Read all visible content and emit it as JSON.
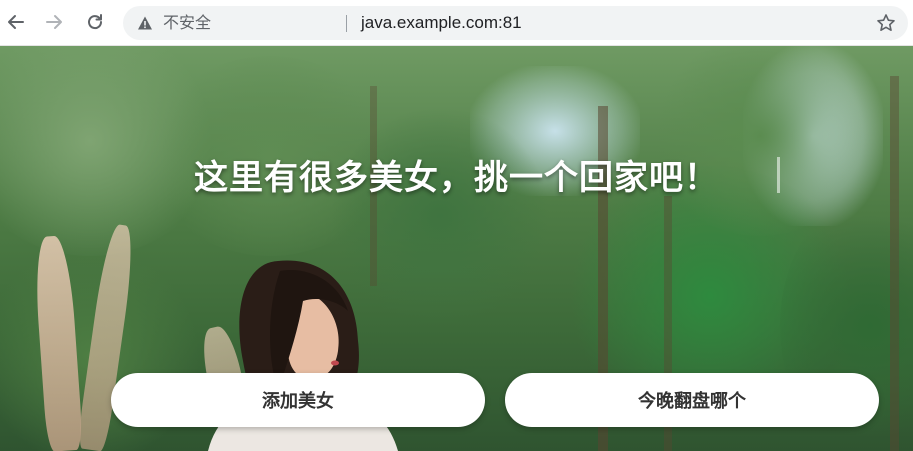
{
  "browser": {
    "security_label": "不安全",
    "url": "java.example.com:81",
    "icons": {
      "back": "arrow-left-icon",
      "forward": "arrow-right-icon",
      "reload": "reload-icon",
      "warning": "warning-triangle-icon",
      "bookmark": "star-icon"
    }
  },
  "page": {
    "headline": "这里有很多美女，挑一个回家吧！",
    "buttons": {
      "add": "添加美女",
      "pick": "今晚翻盘哪个"
    }
  }
}
